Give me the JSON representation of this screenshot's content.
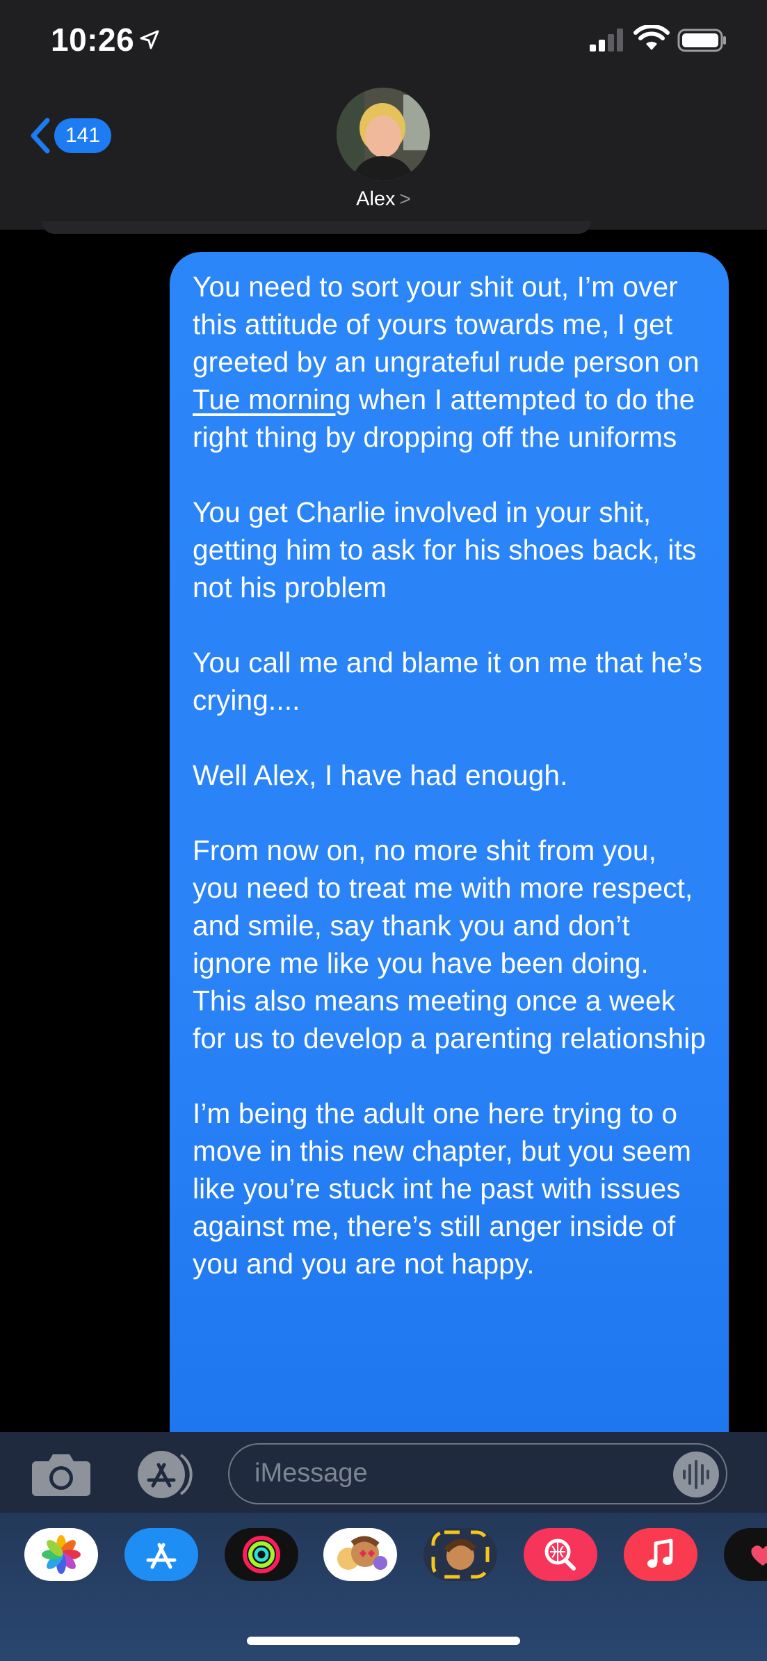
{
  "status_bar": {
    "time": "10:26",
    "icons": [
      "location-arrow-icon",
      "signal-icon",
      "wifi-icon",
      "battery-icon"
    ]
  },
  "header": {
    "back_badge": "141",
    "contact_name": "Alex",
    "contact_chevron": ">"
  },
  "message": {
    "paragraphs": [
      {
        "before": "You need to sort your shit out, I’m over this attitude of yours towards me, I get greeted by an ungrateful rude person on ",
        "link": "Tue morning",
        "after": " when I attempted to do the right thing by dropping off the uniforms"
      },
      {
        "text": "You get Charlie involved in your shit, getting him to ask for his shoes back, its not his problem"
      },
      {
        "text": "You call me and blame it on me that he’s crying...."
      },
      {
        "text": "Well Alex, I have had enough."
      },
      {
        "text": "From now on, no more shit from you, you need to treat me with more respect, and smile, say thank you and don’t ignore me like you have been doing. This also means meeting once a week for us to develop a parenting relationship"
      },
      {
        "text": "I’m being the adult one here trying to o move in this new chapter, but you seem like you’re stuck int he past with issues against me, there’s still anger inside of you and you are not happy."
      }
    ]
  },
  "composer": {
    "placeholder": "iMessage"
  },
  "app_drawer": [
    "photos-app-icon",
    "app-store-app-icon",
    "activity-app-icon",
    "memoji-stickers-app-icon",
    "memoji-app-icon",
    "images-search-app-icon",
    "music-app-icon",
    "heart-app-icon"
  ],
  "colors": {
    "bubble_blue": "#2a83f7",
    "badge_blue": "#1d7cf2",
    "header_bg": "#1f1f21"
  }
}
